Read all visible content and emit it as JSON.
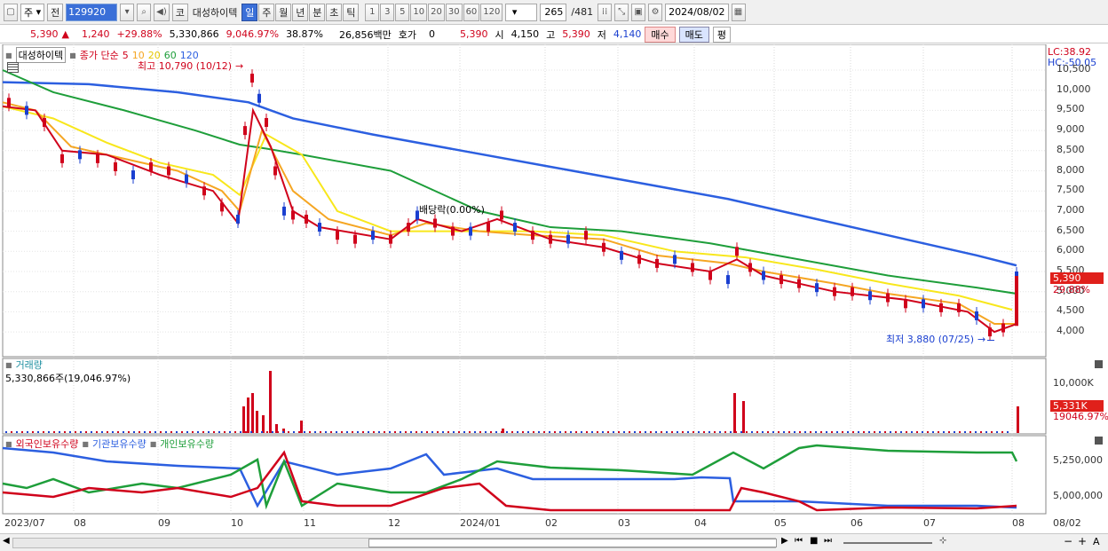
{
  "toolbar": {
    "type_label": "주",
    "prev_label": "전",
    "code": "129920",
    "kospi_label": "코",
    "stock_name": "대성하이텍",
    "periods": [
      "일",
      "주",
      "월",
      "년",
      "분",
      "초",
      "틱"
    ],
    "active_period": "일",
    "intervals": [
      "1",
      "3",
      "5",
      "10",
      "20",
      "30",
      "60",
      "120"
    ],
    "count": "265",
    "total": "/481",
    "date": "2024/08/02"
  },
  "info": {
    "price": "5,390",
    "arrow": "▲",
    "change": "1,240",
    "change_pct": "+29.88%",
    "volume": "5,330,866",
    "vol_pct": "9,046.97%",
    "turnover": "38.87%",
    "amount": "26,856백만",
    "quote_label": "호가",
    "quote_value": "0",
    "quote_price": "5,390",
    "open_label": "시",
    "open": "4,150",
    "high_label": "고",
    "high": "5,390",
    "low_label": "저",
    "low": "4,140",
    "buy_label": "매수",
    "sell_label": "매도",
    "eval_label": "평"
  },
  "price_panel": {
    "name": "대성하이텍",
    "ma_title": "종가 단순",
    "ma_periods": [
      "5",
      "10",
      "20",
      "60",
      "120"
    ],
    "high_annotation": "최고 10,790 (10/12)",
    "low_annotation": "최저 3,880 (07/25)",
    "dividend_annotation": "배당락(0.00%)",
    "lc": "LC:38.92",
    "hc": "HC:-50.05",
    "current_price_tag": "5,390",
    "current_pct_tag": "29.88%",
    "y_ticks": [
      "10,500",
      "10,000",
      "9,500",
      "9,000",
      "8,500",
      "8,000",
      "7,500",
      "7,000",
      "6,500",
      "6,000",
      "5,500",
      "5,000",
      "4,500",
      "4,000"
    ]
  },
  "volume_panel": {
    "title": "거래량",
    "value": "5,330,866주(19,046.97%)",
    "y_tick": "10,000K",
    "tag_value": "5,331K",
    "tag_pct": "19046.97%"
  },
  "holding_panel": {
    "legends": [
      "외국인보유수량",
      "기관보유수량",
      "개인보유수량"
    ],
    "y_ticks": [
      "5,250,000",
      "5,000,000"
    ]
  },
  "x_axis": [
    "2023/07",
    "08",
    "09",
    "10",
    "11",
    "12",
    "2024/01",
    "02",
    "03",
    "04",
    "05",
    "06",
    "07",
    "08",
    "08/02"
  ],
  "colors": {
    "ma5": "#d0021b",
    "ma10": "#f5a623",
    "ma20": "#f8e71c",
    "ma60": "#1e9e3a",
    "ma120": "#2c5fe0",
    "up": "#d0021b",
    "down": "#1a3fd0"
  }
}
